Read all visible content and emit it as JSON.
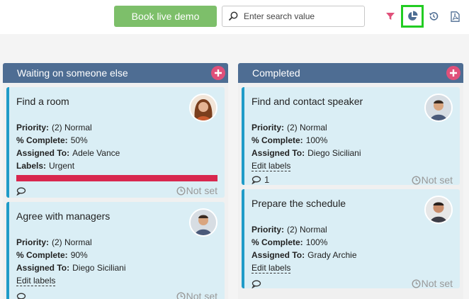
{
  "toolbar": {
    "demo_label": "Book live demo",
    "search_placeholder": "Enter search value",
    "accent_green": "#7dbf6a",
    "icons": [
      "search-icon",
      "filter-icon",
      "pie-chart-icon",
      "history-icon",
      "pdf-icon"
    ]
  },
  "columns": [
    {
      "title": "Waiting on someone else",
      "cards": [
        {
          "title": "Find a room",
          "priority_label": "Priority:",
          "priority": "(2) Normal",
          "complete_label": "% Complete:",
          "complete": "50%",
          "assigned_label": "Assigned To:",
          "assigned": "Adele Vance",
          "labels_label": "Labels:",
          "labels": "Urgent",
          "label_color": "#d8274e",
          "comment_count": "",
          "due": "Not set"
        },
        {
          "title": "Agree with managers",
          "priority_label": "Priority:",
          "priority": "(2) Normal",
          "complete_label": "% Complete:",
          "complete": "90%",
          "assigned_label": "Assigned To:",
          "assigned": "Diego Siciliani",
          "edit_labels": "Edit labels",
          "comment_count": "",
          "due": "Not set"
        }
      ]
    },
    {
      "title": "Completed",
      "cards": [
        {
          "title": "Find and contact speaker",
          "priority_label": "Priority:",
          "priority": "(2) Normal",
          "complete_label": "% Complete:",
          "complete": "100%",
          "assigned_label": "Assigned To:",
          "assigned": "Diego Siciliani",
          "edit_labels": "Edit labels",
          "comment_count": "1",
          "due": "Not set"
        },
        {
          "title": "Prepare the schedule",
          "priority_label": "Priority:",
          "priority": "(2) Normal",
          "complete_label": "% Complete:",
          "complete": "100%",
          "assigned_label": "Assigned To:",
          "assigned": "Grady Archie",
          "edit_labels": "Edit labels",
          "comment_count": "",
          "due": "Not set"
        }
      ]
    }
  ],
  "colors": {
    "header": "#4e6d93",
    "card": "#daeef5",
    "card_border": "#1f9bc8",
    "add_button": "#e0507a",
    "highlight": "#22cc22"
  }
}
